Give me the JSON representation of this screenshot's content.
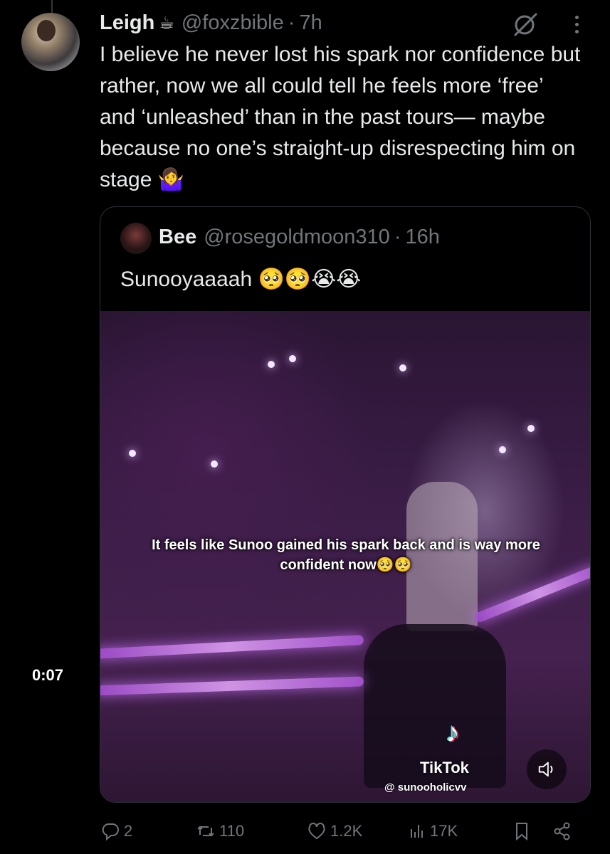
{
  "tweet": {
    "name": "Leigh",
    "name_emoji": "☕",
    "handle": "@foxzbible",
    "separator": "·",
    "time": "7h",
    "text": "I believe he never lost his spark nor confidence but rather, now we all could tell he feels more ‘free’ and ‘unleashed’ than in the past tours— maybe because no one’s straight-up disrespecting him on stage 🤷‍♀️"
  },
  "quote": {
    "name": "Bee",
    "handle": "@rosegoldmoon310",
    "separator": "·",
    "time": "16h",
    "text": "Sunooyaaaah 🥺🥺😭😭",
    "video": {
      "caption_line1": "It feels like Sunoo gained his spark back and is way more",
      "caption_line2": "confident now🥺🥺",
      "duration": "0:07",
      "watermark_brand": "TikTok",
      "watermark_user": "@ sunooholicvv"
    }
  },
  "actions": {
    "replies": "2",
    "retweets": "110",
    "likes": "1.2K",
    "views": "17K"
  },
  "colors": {
    "background": "#000000",
    "text_primary": "#e7e9ea",
    "text_secondary": "#71767b",
    "border": "#2f3336"
  },
  "icons": [
    "grok-icon",
    "more-icon",
    "reply-icon",
    "retweet-icon",
    "like-icon",
    "views-icon",
    "bookmark-icon",
    "share-icon",
    "tiktok-logo-icon",
    "volume-icon"
  ]
}
